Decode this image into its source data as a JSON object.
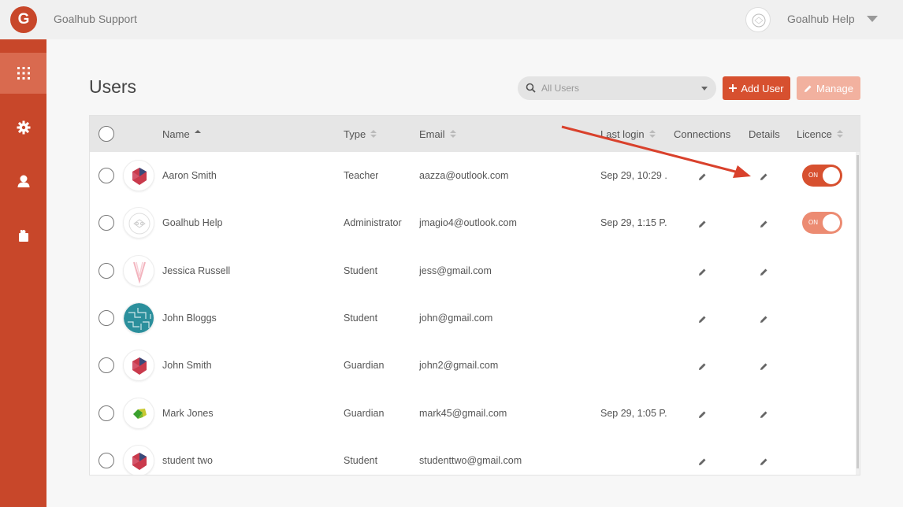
{
  "app": {
    "logo_letter": "G",
    "title": "Goalhub Support",
    "account_name": "Goalhub Help",
    "brand_color": "#c8472a"
  },
  "sidebar": {
    "items": [
      {
        "icon": "grid-icon",
        "active": true
      },
      {
        "icon": "gear-icon",
        "active": false
      },
      {
        "icon": "user-icon",
        "active": false
      },
      {
        "icon": "puzzle-icon",
        "active": false
      }
    ]
  },
  "main": {
    "title": "Users",
    "search": {
      "placeholder": "All Users"
    },
    "add_user_label": "Add User",
    "manage_label": "Manage"
  },
  "table": {
    "columns": {
      "name": "Name",
      "type": "Type",
      "email": "Email",
      "last_login": "Last login",
      "connections": "Connections",
      "details": "Details",
      "licence": "Licence"
    },
    "rows": [
      {
        "name": "Aaron Smith",
        "type": "Teacher",
        "email": "aazza@outlook.com",
        "last_login": "Sep 29, 10:29 ..",
        "licence": "ON",
        "avatar": "hex-red"
      },
      {
        "name": "Goalhub Help",
        "type": "Administrator",
        "email": "jmagio4@outlook.com",
        "last_login": "Sep 29, 1:15 P..",
        "licence": "ON",
        "avatar": "face-outline"
      },
      {
        "name": "Jessica Russell",
        "type": "Student",
        "email": "jess@gmail.com",
        "last_login": "",
        "licence": "",
        "avatar": "pink-v"
      },
      {
        "name": "John Bloggs",
        "type": "Student",
        "email": "john@gmail.com",
        "last_login": "",
        "licence": "",
        "avatar": "teal-pattern"
      },
      {
        "name": "John Smith",
        "type": "Guardian",
        "email": "john2@gmail.com",
        "last_login": "",
        "licence": "",
        "avatar": "hex-red"
      },
      {
        "name": "Mark Jones",
        "type": "Guardian",
        "email": "mark45@gmail.com",
        "last_login": "Sep 29, 1:05 P..",
        "licence": "",
        "avatar": "green-yellow"
      },
      {
        "name": "student two",
        "type": "Student",
        "email": "studenttwo@gmail.com",
        "last_login": "",
        "licence": "",
        "avatar": "hex-red"
      }
    ]
  }
}
